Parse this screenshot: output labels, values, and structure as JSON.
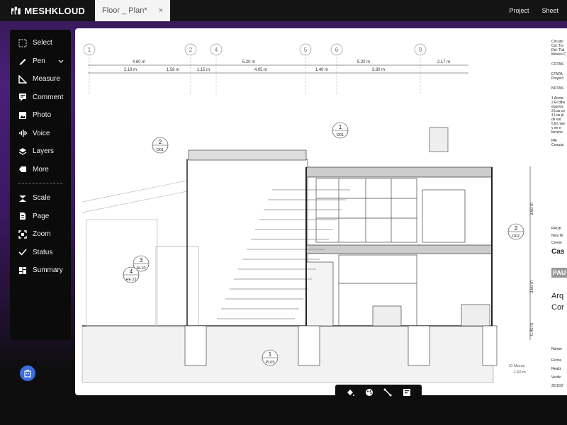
{
  "app": {
    "brand": "MESHKLOUD"
  },
  "tab": {
    "title": "Floor _ Plan*",
    "close": "×"
  },
  "topnav": {
    "project": "Project",
    "sheet": "Sheet"
  },
  "sidebar": {
    "items": [
      {
        "label": "Select",
        "icon": "select-icon"
      },
      {
        "label": "Pen",
        "icon": "pen-icon",
        "has_chevron": true
      },
      {
        "label": "Measure",
        "icon": "ruler-icon"
      },
      {
        "label": "Comment",
        "icon": "comment-icon"
      },
      {
        "label": "Photo",
        "icon": "photo-icon"
      },
      {
        "label": "Voice",
        "icon": "voice-icon"
      },
      {
        "label": "Layers",
        "icon": "layers-icon"
      },
      {
        "label": "More",
        "icon": "tag-icon"
      }
    ],
    "items2": [
      {
        "label": "Scale",
        "icon": "scale-icon"
      },
      {
        "label": "Page",
        "icon": "page-icon"
      },
      {
        "label": "Zoom",
        "icon": "zoom-icon"
      },
      {
        "label": "Status",
        "icon": "check-icon"
      },
      {
        "label": "Summary",
        "icon": "summary-icon"
      }
    ]
  },
  "drawing": {
    "grid_labels": [
      "1",
      "2",
      "4",
      "5",
      "6",
      "9"
    ],
    "dims_top": [
      "4.60 m",
      "5.20 m",
      "5.20 m",
      "2.17 m"
    ],
    "dims_sub": [
      "2.19 m",
      "1.58 m",
      "1.15 m",
      "4.05 m",
      "1.40 m",
      "3.80 m"
    ],
    "vertical_dims": [
      "3.60 m",
      "3.60 m",
      "0.40 m"
    ],
    "tags": [
      {
        "num": "2",
        "ref": "D01"
      },
      {
        "num": "1",
        "ref": "D01"
      },
      {
        "num": "2",
        "ref": "D02"
      },
      {
        "num": "3",
        "ref": "AL10"
      },
      {
        "num": "4",
        "ref": "HE 22"
      },
      {
        "num": "1",
        "ref": "PL05"
      }
    ],
    "level_note": "CI Muros",
    "level_value": "-1.50 m"
  },
  "titleblock": {
    "lines": [
      "Circuito",
      "Col. Tor",
      "Del. Tlal",
      "México C",
      "COTAS",
      "ETAPA",
      "Proyect",
      "NOTAS",
      "1 Acota",
      "2 El dibu",
      "equivoc",
      "3 Las co",
      "4 Los pl",
      "de est",
      "5 El nive",
      "y en e",
      "terreno",
      "PAI",
      "Croquis",
      "PROP",
      "Nina W",
      "Creme",
      "Cas",
      "PAU",
      "Arq",
      "Cor",
      "Númer",
      "Fecha",
      "Realiz",
      "Verific",
      "25/10/2"
    ]
  },
  "colors": {
    "accent": "#3b6ce0",
    "sidebar": "#0b0b0b",
    "purple": "#4a1f78"
  }
}
